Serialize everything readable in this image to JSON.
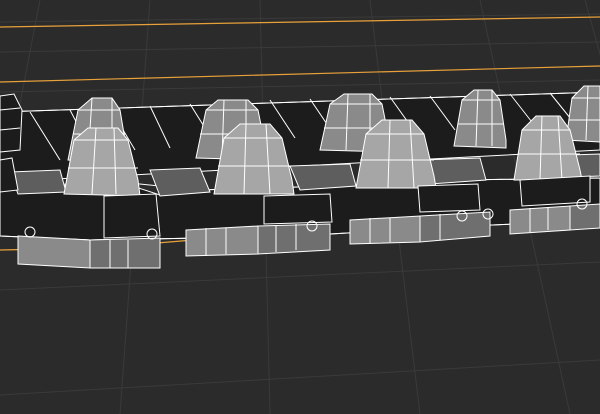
{
  "viewport": {
    "background_color": "#2b2b2b",
    "grid_color": "#3a3a3a",
    "selection_color": "#e8a13a",
    "wireframe_color": "#ffffff",
    "mesh_fill_colors": [
      "#8a8a8a",
      "#6f6f6f",
      "#1c1c1c",
      "#a6a6a6",
      "#5e5e5e"
    ]
  },
  "icons": {
    "grid": "grid-icon",
    "selection_outline": "selection-outline-icon"
  }
}
